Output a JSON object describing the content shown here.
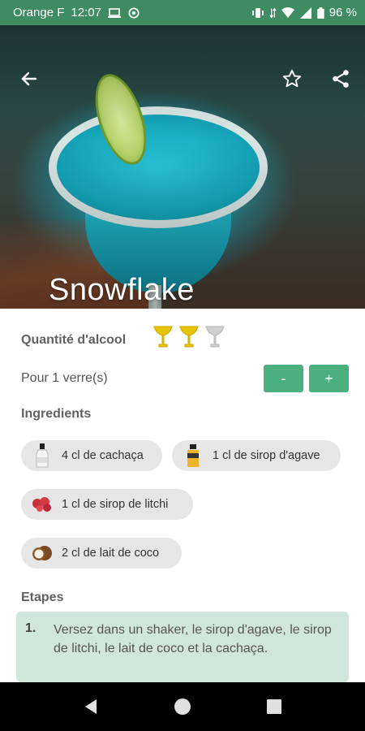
{
  "status_bar": {
    "carrier": "Orange F",
    "time": "12:07",
    "battery": "96 %"
  },
  "hero": {
    "title": "Snowflake"
  },
  "alcohol": {
    "label": "Quantité d'alcool",
    "level": 2,
    "max": 3,
    "filled_color": "#e8c400",
    "empty_color": "#cfcfcf"
  },
  "serving": {
    "label": "Pour 1 verre(s)",
    "minus_label": "-",
    "plus_label": "+"
  },
  "ingredients": {
    "title": "Ingredients",
    "items": [
      {
        "label": "4 cl de cachaça",
        "icon": "bottle-icon"
      },
      {
        "label": "1 cl de sirop d'agave",
        "icon": "syrup-bottle-icon"
      },
      {
        "label": "1 cl de sirop de litchi",
        "icon": "lychee-icon"
      },
      {
        "label": "2 cl de lait de coco",
        "icon": "coconut-icon"
      }
    ]
  },
  "steps": {
    "title": "Etapes",
    "items": [
      {
        "number": "1.",
        "text": "Versez dans un shaker, le sirop d'agave, le sirop de litchi, le lait de coco et la cachaça."
      }
    ]
  },
  "colors": {
    "status_bar": "#3f8c63",
    "accent": "#4caf80",
    "step_card": "#cfe6da"
  }
}
